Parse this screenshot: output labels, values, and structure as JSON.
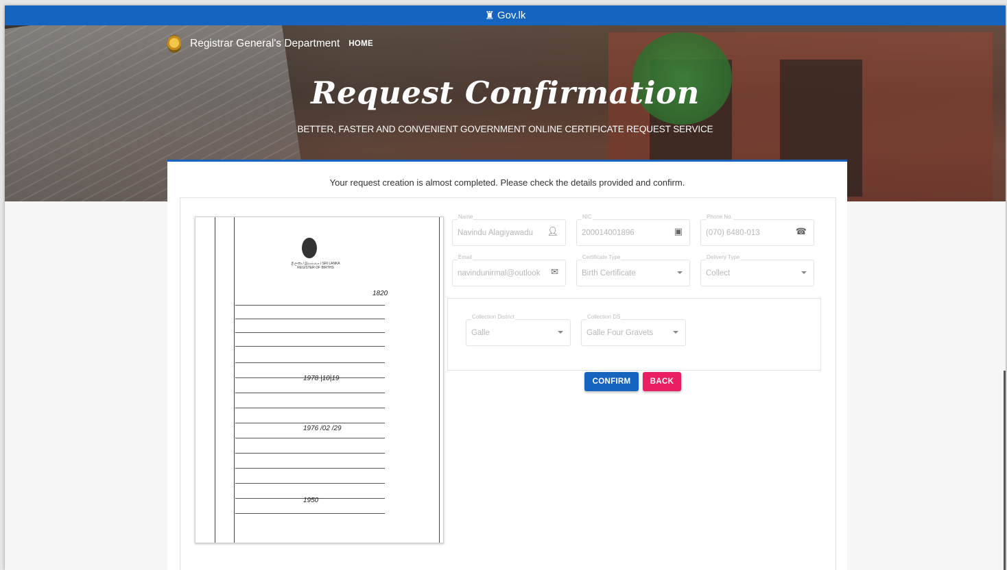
{
  "gov_bar": {
    "text": "Gov.lk",
    "icon": "lion-icon"
  },
  "header": {
    "department": "Registrar General's Department",
    "home_link": "HOME",
    "title": "Request Confirmation",
    "subtitle": "BETTER, FASTER AND CONVENIENT GOVERNMENT ONLINE CERTIFICATE REQUEST SERVICE"
  },
  "card": {
    "message": "Your request creation is almost completed. Please check the details provided and confirm."
  },
  "document": {
    "crest_caption": "ශ්‍රී ලංකා / இலங்கை / SRI LANKA",
    "register_title": "REGISTER OF BIRTHS",
    "year_mark": "1820",
    "handwritten": [
      "1978 |10|19",
      "1976 /02 /29",
      "1950"
    ]
  },
  "form": {
    "name": {
      "label": "Name",
      "value": "Navindu Alagiyawadu",
      "icon": "person-icon"
    },
    "nic": {
      "label": "NIC",
      "value": "200014001896",
      "icon": "id-card-icon"
    },
    "phone": {
      "label": "Phone No.",
      "value": "(070) 6480-013",
      "icon": "phone-icon"
    },
    "email": {
      "label": "Email",
      "value": "navindunirmal@outlook",
      "icon": "mail-icon"
    },
    "certificate_type": {
      "label": "Certificate Type",
      "value": "Birth Certificate"
    },
    "delivery_type": {
      "label": "Delivery Type",
      "value": "Collect"
    },
    "collection_district": {
      "label": "Collection District",
      "value": "Galle"
    },
    "collection_ds": {
      "label": "Collection DS",
      "value": "Galle Four Gravets"
    }
  },
  "buttons": {
    "confirm": "CONFIRM",
    "back": "BACK"
  },
  "colors": {
    "primary": "#1565c0",
    "back_button": "#e91e63"
  }
}
